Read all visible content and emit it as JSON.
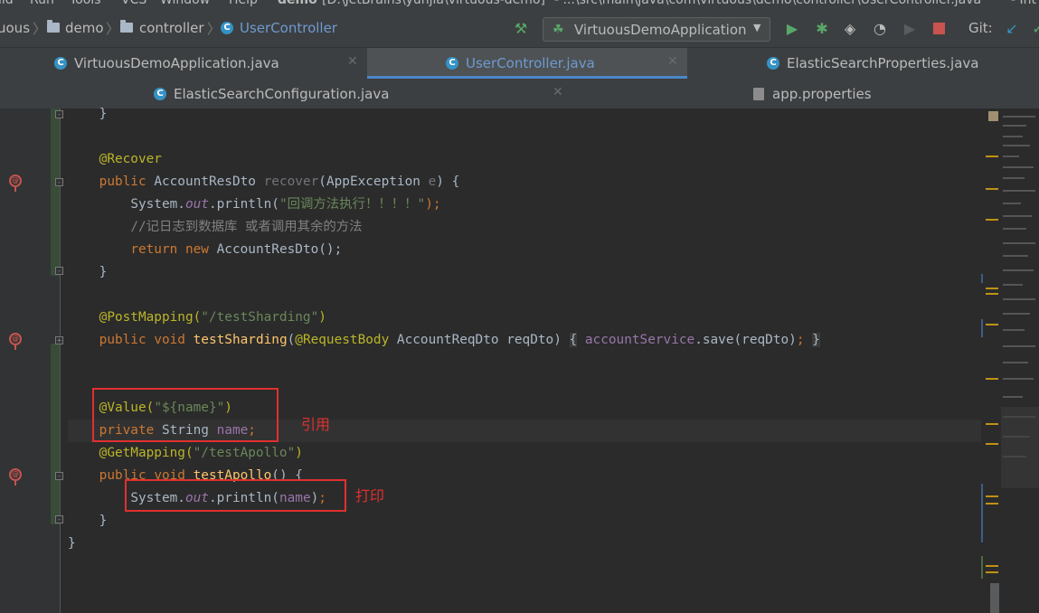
{
  "menubar": {
    "items": [
      "ild",
      "Run",
      "Tools",
      "VCS",
      "Window",
      "Help",
      "demo",
      "[D:\\JetBrains\\yunjia\\virtuous-demo]",
      "- ...\\src\\main\\java\\com\\virtuous\\demo\\controller\\UserController.java",
      "- Int"
    ]
  },
  "breadcrumb": {
    "items": [
      "uous",
      "demo",
      "controller",
      "UserController"
    ]
  },
  "toolbar": {
    "run_config": "VirtuousDemoApplication",
    "git_label": "Git:"
  },
  "tabs": {
    "row1": [
      {
        "label": "VirtuousDemoApplication.java"
      },
      {
        "label": "UserController.java"
      },
      {
        "label": "ElasticSearchProperties.java"
      }
    ],
    "row2": [
      {
        "label": "ElasticSearchConfiguration.java"
      },
      {
        "label": "app.properties"
      }
    ]
  },
  "code": {
    "l1_brace": "}",
    "l3_ann": "@Recover",
    "l4_public": "public",
    "l4_type": "AccountResDto",
    "l4_method": "recover",
    "l4_ptype": "AppException",
    "l4_pname": "e",
    "l4_tail": ") {",
    "l5_sys": "System.",
    "l5_out": "out",
    "l5_println": ".println(",
    "l5_str": "\"回调方法执行！！！！\"",
    "l5_end": ");",
    "l6_comment": "//记日志到数据库 或者调用其余的方法",
    "l7_return": "return",
    "l7_new": "new",
    "l7_rest": "AccountResDto();",
    "l8_brace": "}",
    "l10_ann": "@PostMapping(",
    "l10_str": "\"/testSharding\"",
    "l10_end": ")",
    "l11_public": "public",
    "l11_void": "void",
    "l11_method": "testSharding",
    "l11_open": "(",
    "l11_ann": "@RequestBody",
    "l11_params": "AccountReqDto reqDto)",
    "l11_lb": "{",
    "l11_field": "accountService",
    "l11_call": ".save(reqDto)",
    "l11_semi": ";",
    "l11_rb": "}",
    "l14_ann": "@Value(",
    "l14_str": "\"${name}\"",
    "l14_end": ")",
    "l15_private": "private",
    "l15_type": "String",
    "l15_field": "name",
    "l15_semi": ";",
    "l16_ann": "@GetMapping(",
    "l16_str": "\"/testApollo\"",
    "l16_end": ")",
    "l17_public": "public",
    "l17_void": "void",
    "l17_method": "testApollo",
    "l17_tail": "() {",
    "l18_sys": "System.",
    "l18_out": "out",
    "l18_println": ".println(",
    "l18_field": "name",
    "l18_end": ")",
    "l18_semi": ";",
    "l19_brace": "}",
    "l20_brace": "}"
  },
  "annotations": {
    "reference_label": "引用",
    "print_label": "打印"
  },
  "colors": {
    "keyword": "#cc7832",
    "annotation": "#bbb529",
    "string": "#6a8759",
    "comment": "#808080",
    "field": "#9876aa",
    "highlight_box": "#e03030",
    "active_tab_text": "#6e9ad0"
  }
}
